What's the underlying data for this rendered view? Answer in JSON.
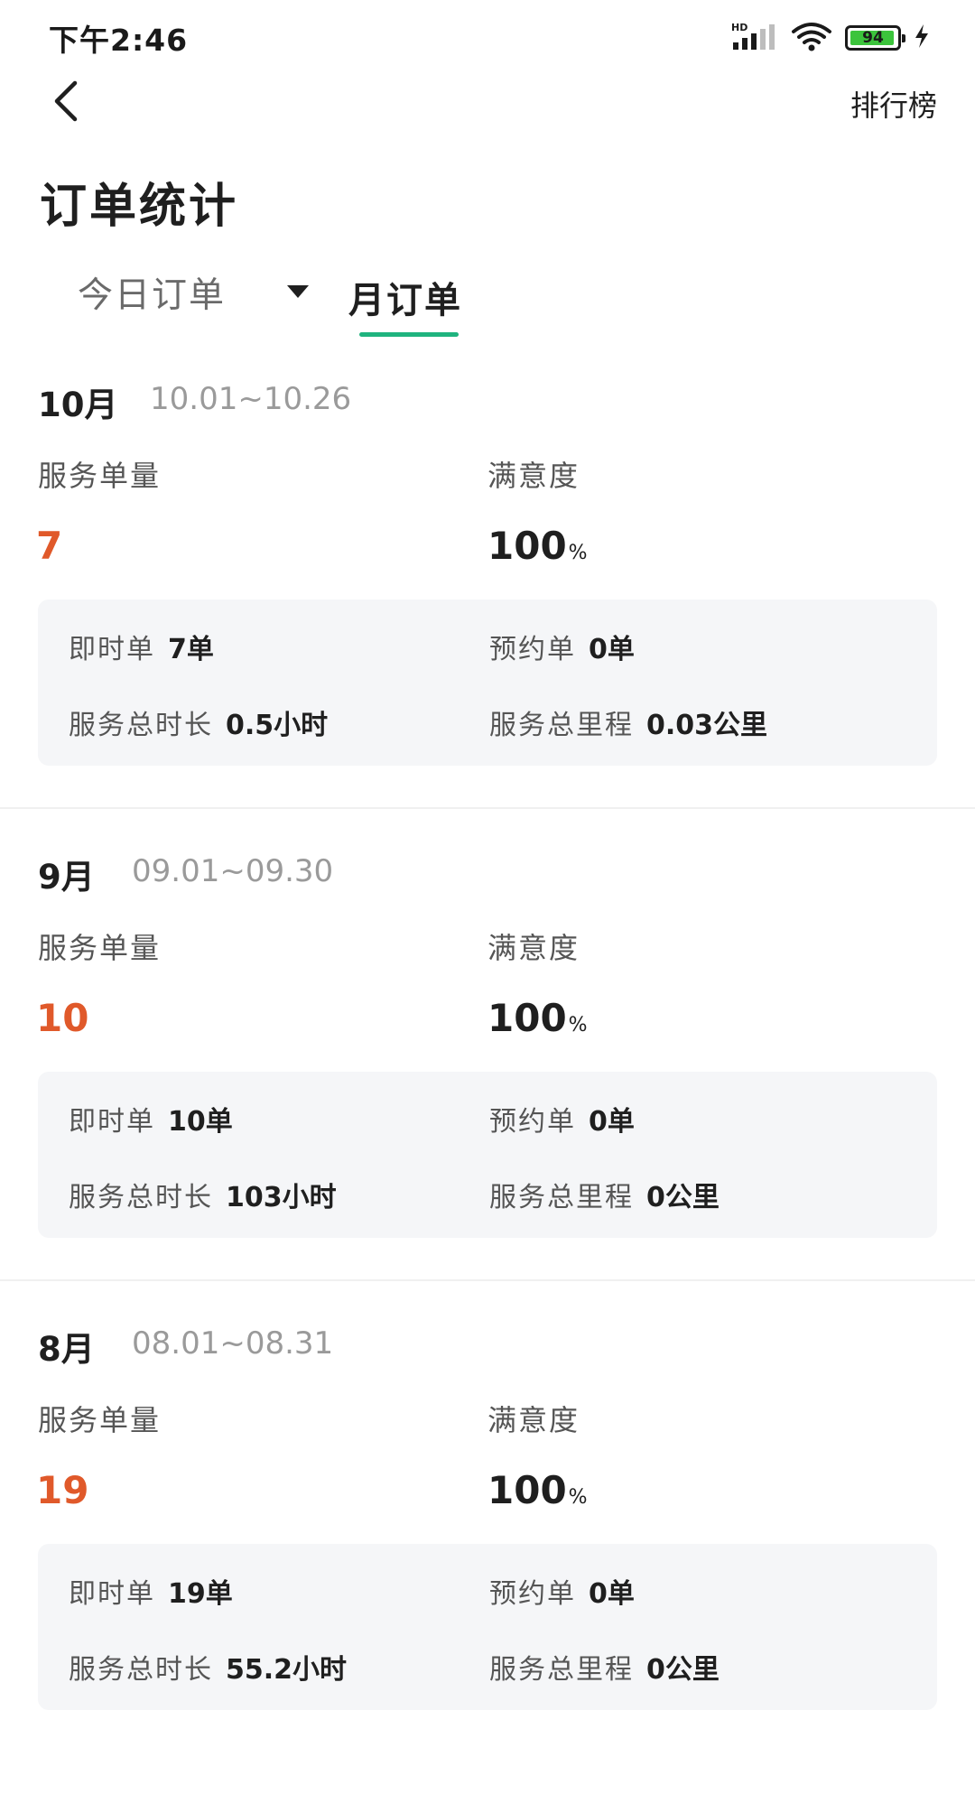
{
  "status_bar": {
    "time": "下午2:46",
    "battery_level": "94",
    "icons": [
      "hd-signal-icon",
      "wifi-icon",
      "battery-icon",
      "charging-icon"
    ]
  },
  "header": {
    "back_icon": "chevron-left-icon",
    "ranking_label": "排行榜",
    "title": "订单统计"
  },
  "tabs": {
    "today_label": "今日订单",
    "dropdown_icon": "triangle-down-icon",
    "month_label": "月订单",
    "active": "month"
  },
  "colors": {
    "accent": "#1fb37e",
    "count": "#e0592a",
    "card_bg": "#f5f6f8"
  },
  "months": [
    {
      "title": "10月",
      "range": "10.01~10.26",
      "service_label": "服务单量",
      "service_count": "7",
      "satisfaction_label": "满意度",
      "satisfaction_value": "100",
      "satisfaction_unit": "%",
      "instant_label": "即时单",
      "instant_value": "7单",
      "reserve_label": "预约单",
      "reserve_value": "0单",
      "duration_label": "服务总时长",
      "duration_value": "0.5小时",
      "mileage_label": "服务总里程",
      "mileage_value": "0.03公里"
    },
    {
      "title": "9月",
      "range": "09.01~09.30",
      "service_label": "服务单量",
      "service_count": "10",
      "satisfaction_label": "满意度",
      "satisfaction_value": "100",
      "satisfaction_unit": "%",
      "instant_label": "即时单",
      "instant_value": "10单",
      "reserve_label": "预约单",
      "reserve_value": "0单",
      "duration_label": "服务总时长",
      "duration_value": "103小时",
      "mileage_label": "服务总里程",
      "mileage_value": "0公里"
    },
    {
      "title": "8月",
      "range": "08.01~08.31",
      "service_label": "服务单量",
      "service_count": "19",
      "satisfaction_label": "满意度",
      "satisfaction_value": "100",
      "satisfaction_unit": "%",
      "instant_label": "即时单",
      "instant_value": "19单",
      "reserve_label": "预约单",
      "reserve_value": "0单",
      "duration_label": "服务总时长",
      "duration_value": "55.2小时",
      "mileage_label": "服务总里程",
      "mileage_value": "0公里"
    }
  ]
}
